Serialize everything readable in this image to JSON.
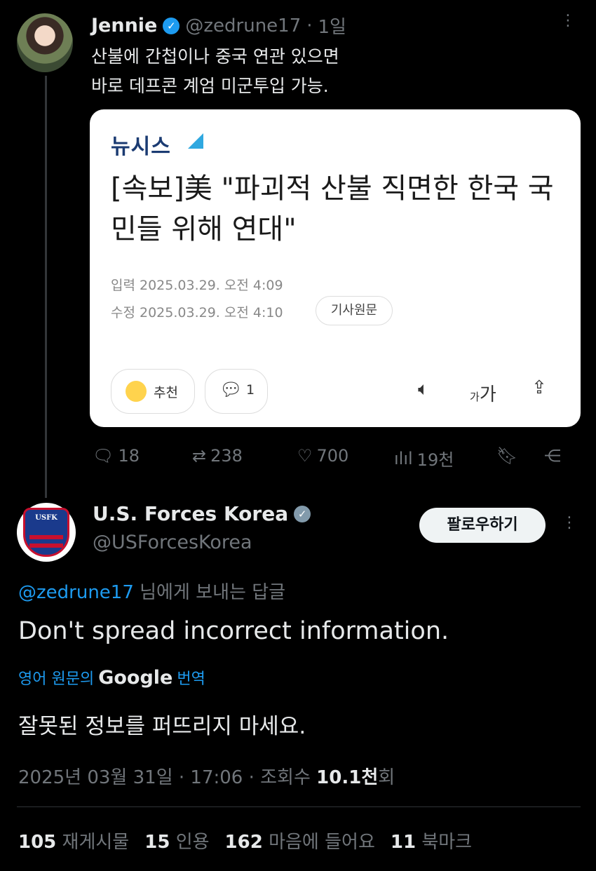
{
  "tweet1": {
    "author_name": "Jennie",
    "handle": "@zedrune17",
    "separator": "·",
    "time": "1일",
    "line1": "산불에 간첩이나 중국 연관 있으면",
    "line2": "바로 데프콘 계엄 미군투입 가능.",
    "card": {
      "source": "뉴시스",
      "headline": "[속보]美 \"파괴적 산불 직면한 한국 국민들 위해 연대\"",
      "input_time": "입력 2025.03.29. 오전 4:09",
      "edit_time": "수정 2025.03.29. 오전 4:10",
      "original_button": "기사원문",
      "like_label": "추천",
      "comment_count": "1",
      "font_size_label_small": "가",
      "font_size_label_big": "가"
    },
    "actions": {
      "replies": "18",
      "retweets": "238",
      "likes": "700",
      "views": "19천"
    }
  },
  "tweet2": {
    "author_name": "U.S. Forces Korea",
    "handle": "@USForcesKorea",
    "follow_label": "팔로우하기",
    "avatar_text": "USFK",
    "reply_to_handle": "@zedrune17",
    "reply_to_suffix": " 님에게 보내는 답글",
    "text": "Don't spread incorrect information.",
    "translate_prefix": "영어 원문의",
    "translate_brand": "Google",
    "translate_suffix": "번역",
    "translated_text": "잘못된 정보를 퍼뜨리지 마세요.",
    "timestamp": "2025년 03월 31일 · 17:06 · 조회수 ",
    "views_num": "10.1천",
    "views_suffix": "회",
    "stats": [
      {
        "num": "105",
        "label": "재게시물"
      },
      {
        "num": "15",
        "label": "인용"
      },
      {
        "num": "162",
        "label": "마음에 들어요"
      },
      {
        "num": "11",
        "label": "북마크"
      }
    ]
  },
  "colors": {
    "background": "#000000",
    "text": "#e7e9ea",
    "muted": "#71767b",
    "link": "#1d9bf0"
  },
  "icons": [
    "verified-badge-icon",
    "more-icon",
    "reply-icon",
    "retweet-icon",
    "like-icon",
    "views-icon",
    "bookmark-icon",
    "share-icon",
    "speaker-icon",
    "font-size-icon",
    "card-share-icon",
    "smile-icon",
    "comment-icon"
  ]
}
